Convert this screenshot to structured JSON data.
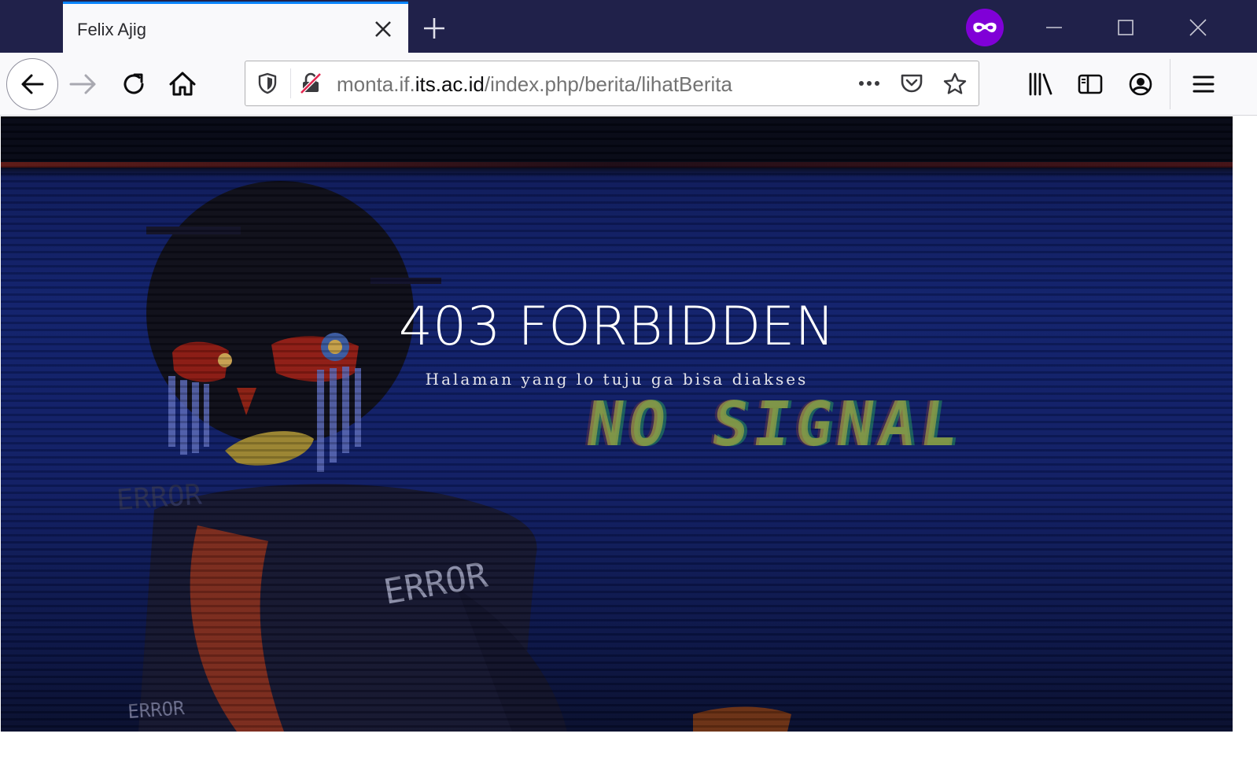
{
  "browser": {
    "tab": {
      "title": "Felix Ajig"
    },
    "private_mode_color": "#8000d7",
    "accent": "#0a84ff"
  },
  "urlbar": {
    "prefix": "monta.if.",
    "domain": "its.ac.id",
    "path": "/index.php/berita/lihatBerita"
  },
  "page": {
    "heading": "403 FORBIDDEN",
    "subheading": "Halaman yang lo tuju ga bisa diakses",
    "background_text": "NO SIGNAL",
    "art_labels": [
      "ERROR",
      "ERROR",
      "ERROR"
    ]
  },
  "icons": [
    "close-icon",
    "plus-icon",
    "private-mask-icon",
    "minimize-icon",
    "maximize-icon",
    "window-close-icon",
    "back-arrow-icon",
    "forward-arrow-icon",
    "reload-icon",
    "home-icon",
    "shield-icon",
    "insecure-lock-icon",
    "more-icon",
    "pocket-icon",
    "star-icon",
    "library-icon",
    "sidebar-icon",
    "account-icon",
    "hamburger-menu-icon"
  ]
}
